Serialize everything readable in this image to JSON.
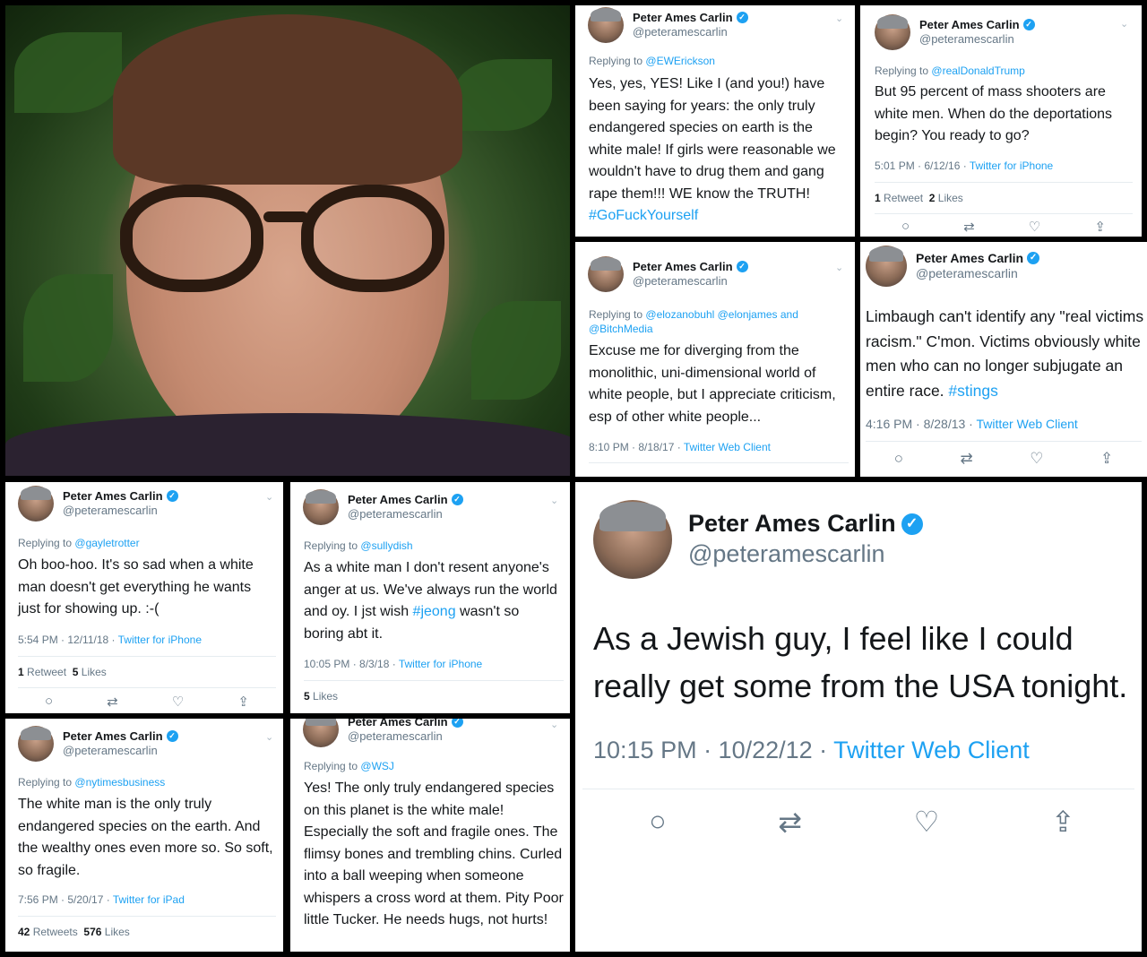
{
  "colors": {
    "accent": "#1da1f2",
    "text": "#14171a",
    "muted": "#657786"
  },
  "profile": {
    "name": "Peter Ames Carlin",
    "handle": "@peteramescarlin",
    "verified_glyph": "✓"
  },
  "action_icons": {
    "reply": "reply-icon",
    "retweet": "retweet-icon",
    "like": "like-icon",
    "share": "share-icon"
  },
  "tweets": [
    {
      "reply_prefix": "Replying to",
      "reply_to": "@EWErickson",
      "text": "Yes, yes, YES! Like I (and you!) have been saying for years: the only truly endangered species on earth is the white male! If girls were reasonable we wouldn't have to drug them and gang rape them!!! WE know the TRUTH!",
      "hashtag": "#GoFuckYourself"
    },
    {
      "reply_prefix": "Replying to",
      "reply_to": "@realDonaldTrump",
      "text": "But 95 percent of mass shooters are white men. When do the deportations begin? You ready to go?",
      "time": "5:01 PM · 6/12/16 · ",
      "source": "Twitter for iPhone",
      "retweets_count": "1",
      "retweets_label": "Retweet",
      "likes_count": "2",
      "likes_label": "Likes"
    },
    {
      "reply_prefix": "Replying to",
      "reply_to": "@elozanobuhl @elonjames and @BitchMedia",
      "text": "Excuse me for diverging from the monolithic, uni-dimensional world of white people, but I appreciate criticism, esp of other white people...",
      "time": "8:10 PM · 8/18/17 · ",
      "source": "Twitter Web Client"
    },
    {
      "text": "Limbaugh can't identify any \"real victims of racism.\" C'mon. Victims obviously white men who can no longer subjugate an entire race.",
      "hashtag": "#stings",
      "time": "4:16 PM · 8/28/13 · ",
      "source": "Twitter Web Client"
    },
    {
      "reply_prefix": "Replying to",
      "reply_to": "@gayletrotter",
      "text": "Oh boo-hoo. It's so sad when a white man doesn't get everything he wants just for showing up. :-(",
      "time": "5:54 PM · 12/11/18 · ",
      "source": "Twitter for iPhone",
      "retweets_count": "1",
      "retweets_label": "Retweet",
      "likes_count": "5",
      "likes_label": "Likes"
    },
    {
      "reply_prefix": "Replying to",
      "reply_to": "@sullydish",
      "text_before": "As a white man I don't resent anyone's anger at us. We've always run the world and oy. I jst wish",
      "hashtag": "#jeong",
      "text_after": "wasn't so boring abt it.",
      "time": "10:05 PM · 8/3/18 · ",
      "source": "Twitter for iPhone",
      "likes_count": "5",
      "likes_label": "Likes"
    },
    {
      "text": "As a Jewish guy, I feel like I could really get some from the USA tonight.",
      "time": "10:15 PM · 10/22/12 · ",
      "source": "Twitter Web Client"
    },
    {
      "reply_prefix": "Replying to",
      "reply_to": "@nytimesbusiness",
      "text": "The white man is the only truly endangered species on the earth. And the wealthy ones even more so. So soft, so fragile.",
      "time": "7:56 PM · 5/20/17 · ",
      "source": "Twitter for iPad",
      "retweets_count": "42",
      "retweets_label": "Retweets",
      "likes_count": "576",
      "likes_label": "Likes"
    },
    {
      "reply_prefix": "Replying to",
      "reply_to": "@WSJ",
      "text": "Yes! The only truly endangered species on this planet is the white male! Especially the soft and fragile ones. The flimsy bones and trembling chins. Curled into a ball weeping when someone whispers a cross word at them. Pity Poor little Tucker. He needs hugs, not hurts!"
    }
  ]
}
